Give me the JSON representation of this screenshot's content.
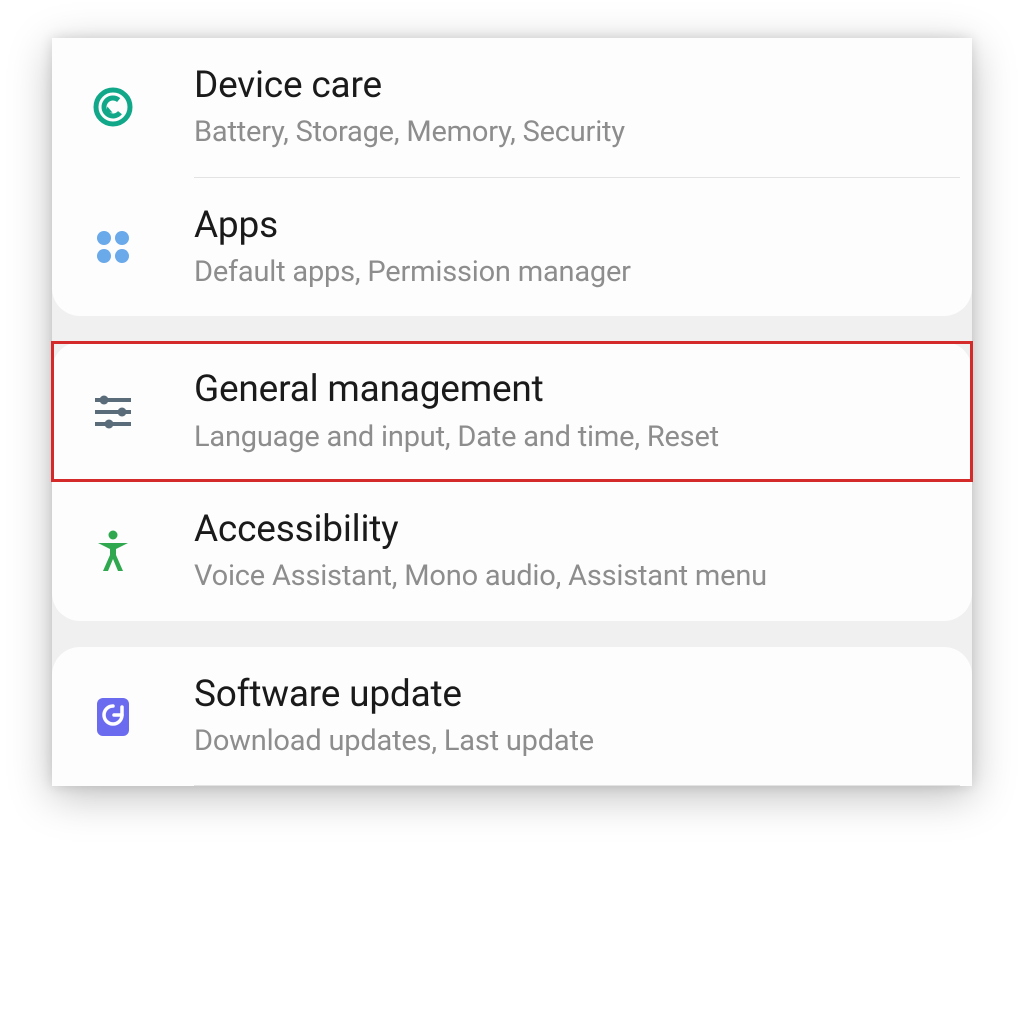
{
  "settings": {
    "groups": [
      {
        "items": [
          {
            "id": "device-care",
            "title": "Device care",
            "subtitle": "Battery, Storage, Memory, Security",
            "icon": "device-care"
          },
          {
            "id": "apps",
            "title": "Apps",
            "subtitle": "Default apps, Permission manager",
            "icon": "apps"
          }
        ]
      },
      {
        "items": [
          {
            "id": "general-management",
            "title": "General management",
            "subtitle": "Language and input, Date and time, Reset",
            "icon": "sliders",
            "highlighted": true
          },
          {
            "id": "accessibility",
            "title": "Accessibility",
            "subtitle": "Voice Assistant, Mono audio, Assistant menu",
            "icon": "accessibility"
          }
        ]
      },
      {
        "items": [
          {
            "id": "software-update",
            "title": "Software update",
            "subtitle": "Download updates, Last update",
            "icon": "update"
          }
        ]
      }
    ]
  },
  "colors": {
    "device_care": "#11a88a",
    "apps": "#6aa9ea",
    "sliders": "#5a6b7a",
    "accessibility": "#2fa84f",
    "update": "#6b6bf0",
    "highlight": "#d42a2a"
  }
}
